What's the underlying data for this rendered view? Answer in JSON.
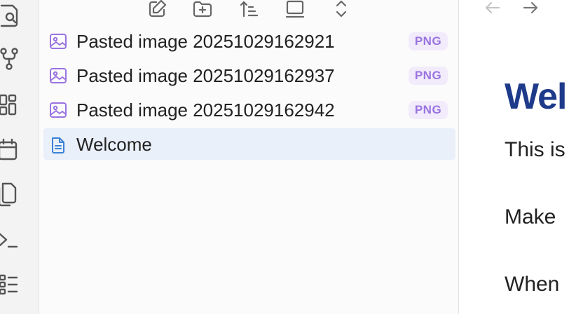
{
  "ribbon": {
    "items": [
      {
        "icon": "search-icon"
      },
      {
        "icon": "graph-view-icon"
      },
      {
        "icon": "canvas-icon"
      },
      {
        "icon": "calendar-icon"
      },
      {
        "icon": "copy-icon"
      },
      {
        "icon": "terminal-icon"
      },
      {
        "icon": "list-icon"
      }
    ]
  },
  "explorer": {
    "toolbar": [
      {
        "icon": "new-note-icon"
      },
      {
        "icon": "new-folder-icon"
      },
      {
        "icon": "sort-icon"
      },
      {
        "icon": "collapse-icon"
      },
      {
        "icon": "expand-collapse-icon"
      }
    ],
    "files": [
      {
        "name": "Pasted image 20251029162921",
        "badge": "PNG",
        "icon": "image-file-icon",
        "active": false
      },
      {
        "name": "Pasted image 20251029162937",
        "badge": "PNG",
        "icon": "image-file-icon",
        "active": false
      },
      {
        "name": "Pasted image 20251029162942",
        "badge": "PNG",
        "icon": "image-file-icon",
        "active": false
      },
      {
        "name": "Welcome",
        "badge": "",
        "icon": "document-file-icon",
        "active": true
      }
    ]
  },
  "editor": {
    "heading": "Wel",
    "paragraphs": [
      "This is",
      "Make",
      "When"
    ]
  },
  "colors": {
    "accent": "#1e3a8a",
    "badge_bg": "#f1ebfc",
    "badge_text": "#9a73e0",
    "image_icon": "#9a73e0",
    "doc_icon": "#3b82d6",
    "active_row": "#e9f0f9"
  }
}
